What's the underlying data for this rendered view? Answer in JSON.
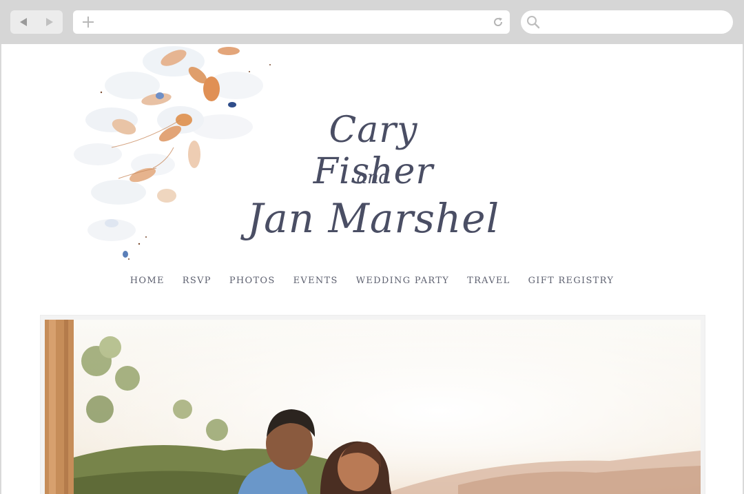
{
  "browser": {
    "back_icon": "back-arrow-icon",
    "forward_icon": "forward-arrow-icon",
    "new_tab_icon": "plus-icon",
    "reload_icon": "reload-icon",
    "search_icon": "search-icon"
  },
  "header": {
    "name_one": "Cary Fisher",
    "conjunction": "and",
    "name_two": "Jan Marshel"
  },
  "nav": {
    "items": [
      "HOME",
      "RSVP",
      "PHOTOS",
      "EVENTS",
      "WEDDING PARTY",
      "TRAVEL",
      "GIFT REGISTRY"
    ]
  },
  "colors": {
    "ink": "#4a4e64",
    "menu_text": "#5e6170",
    "chrome": "#d6d6d6",
    "floral_orange": "#d98c4e",
    "floral_blue": "#5b7fb8"
  }
}
